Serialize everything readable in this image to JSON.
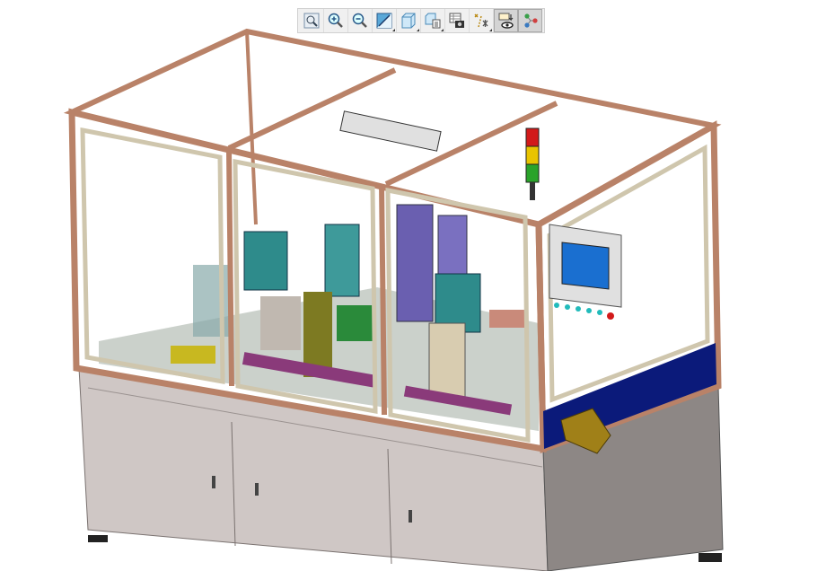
{
  "toolbar": {
    "buttons": [
      {
        "icon": "zoom-fit-icon",
        "pressed": false,
        "flyout": false
      },
      {
        "icon": "zoom-in-icon",
        "pressed": false,
        "flyout": false
      },
      {
        "icon": "zoom-out-icon",
        "pressed": false,
        "flyout": false
      },
      {
        "icon": "display-style-icon",
        "pressed": false,
        "flyout": true
      },
      {
        "icon": "standard-orientation-icon",
        "pressed": false,
        "flyout": true
      },
      {
        "icon": "saved-views-icon",
        "pressed": false,
        "flyout": true
      },
      {
        "icon": "view-manager-icon",
        "pressed": false,
        "flyout": false
      },
      {
        "icon": "datum-display-icon",
        "pressed": false,
        "flyout": true
      },
      {
        "icon": "annotation-display-icon",
        "pressed": true,
        "flyout": false
      },
      {
        "icon": "spin-center-icon",
        "pressed": true,
        "flyout": false
      }
    ]
  },
  "model": {
    "colors": {
      "frame": "#b98268",
      "cabinet": "#cfc7c5",
      "side_panel": "#8d8785",
      "blue_band": "#0b1a7a",
      "hmi_screen": "#1a6fd0",
      "light_red": "#d21a1a",
      "light_yellow": "#e8c400",
      "light_green": "#2aa32a"
    }
  }
}
